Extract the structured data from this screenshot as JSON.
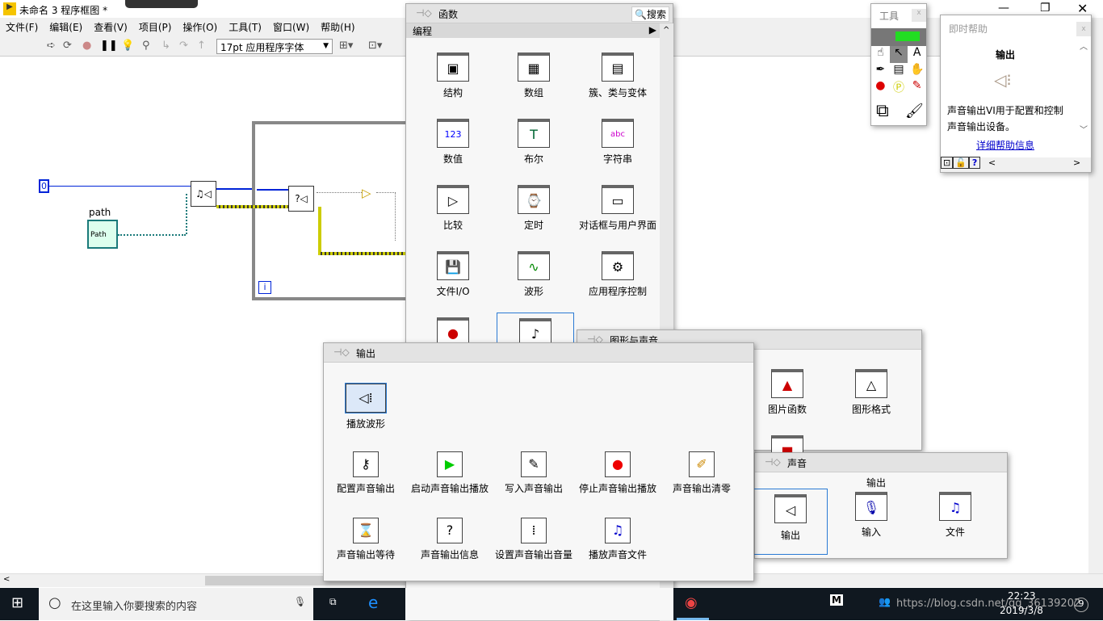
{
  "window": {
    "title": "未命名 3 程序框图 *"
  },
  "menu": [
    "文件(F)",
    "编辑(E)",
    "查看(V)",
    "项目(P)",
    "操作(O)",
    "工具(T)",
    "窗口(W)",
    "帮助(H)"
  ],
  "toolbar": {
    "font": "17pt 应用程序字体"
  },
  "diagram": {
    "constant": "0",
    "path_label": "path",
    "path_control": "Path",
    "loop_index": "i"
  },
  "functions_palette": {
    "title": "函数",
    "search": "搜索",
    "category": "编程",
    "items": [
      "结构",
      "数组",
      "簇、类与变体",
      "数值",
      "布尔",
      "字符串",
      "比较",
      "定时",
      "对话框与用户界面",
      "文件I/O",
      "波形",
      "应用程序控制"
    ]
  },
  "graphics_palette": {
    "title": "图形与声音",
    "items": [
      "图片函数",
      "图形格式"
    ]
  },
  "sound_palette": {
    "title": "声音",
    "section": "输出",
    "items": [
      "输出",
      "输入",
      "文件"
    ]
  },
  "output_palette": {
    "title": "输出",
    "featured": "播放波形",
    "items": [
      "配置声音输出",
      "启动声音输出播放",
      "写入声音输出",
      "停止声音输出播放",
      "声音输出清零",
      "声音输出等待",
      "声音输出信息",
      "设置声音输出音量",
      "播放声音文件"
    ]
  },
  "tools_palette": {
    "title": "工具"
  },
  "context_help": {
    "title": "即时帮助",
    "heading": "输出",
    "description": "声音输出VI用于配置和控制声音输出设备。",
    "link": "详细帮助信息"
  },
  "taskbar": {
    "search_placeholder": "在这里输入你要搜索的内容",
    "time": "22:23",
    "date": "2019/3/8",
    "watermark": "https://blog.csdn.net/qq_36139202",
    "notifications": "9"
  }
}
